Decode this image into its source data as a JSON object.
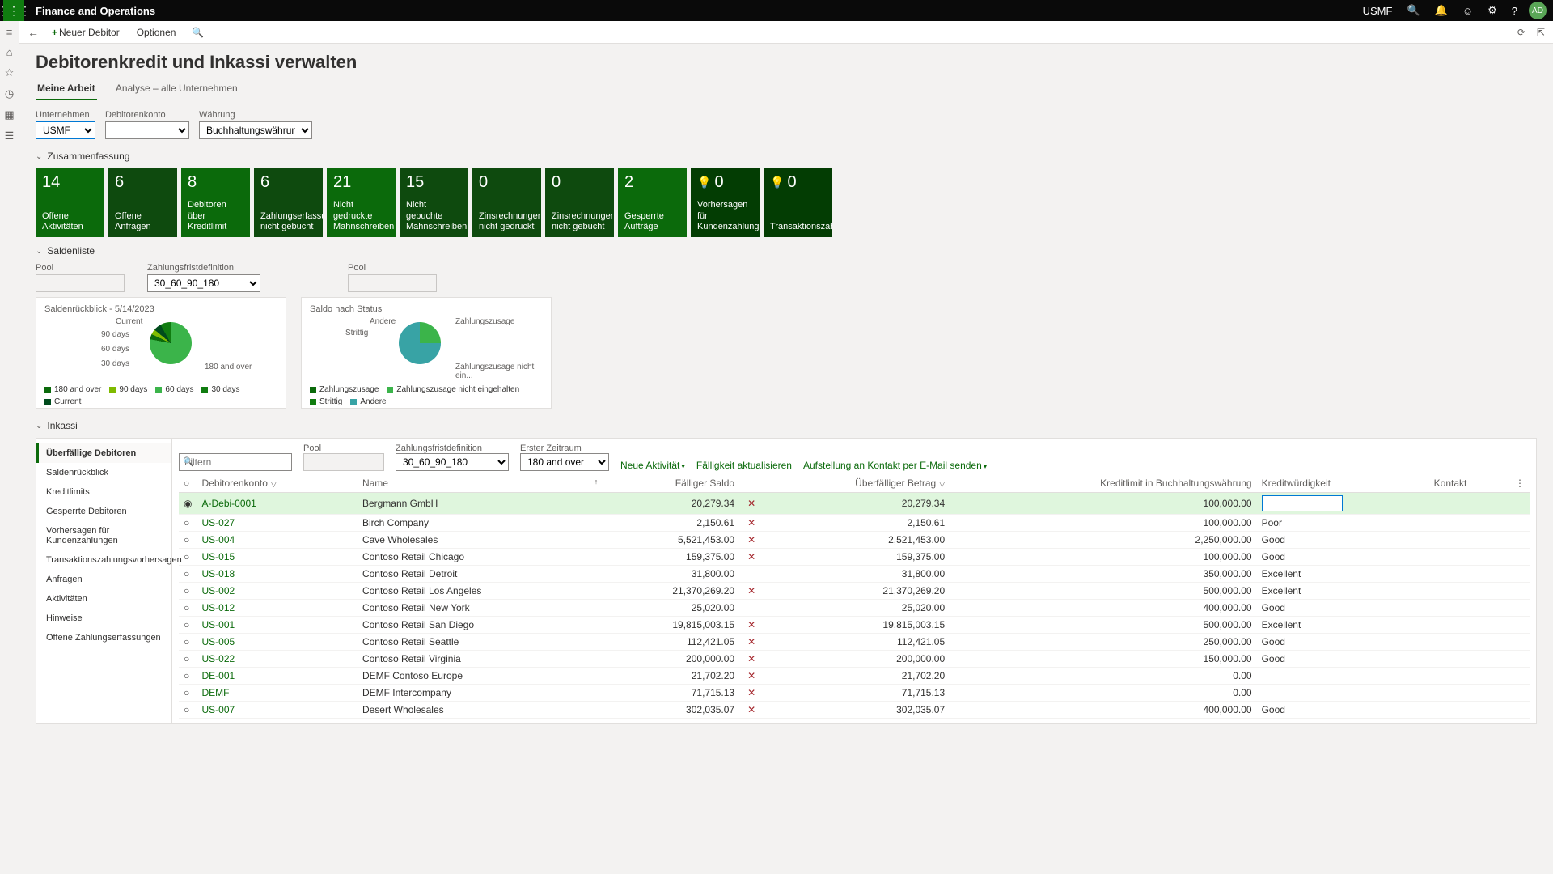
{
  "topbar": {
    "brand": "Finance and Operations",
    "company": "USMF",
    "avatar": "AD"
  },
  "actionbar": {
    "new": "Neuer Debitor",
    "options": "Optionen"
  },
  "page": {
    "title": "Debitorenkredit und Inkassi verwalten",
    "tab1": "Meine Arbeit",
    "tab2": "Analyse – alle Unternehmen"
  },
  "filters": {
    "company_lbl": "Unternehmen",
    "company_val": "USMF",
    "account_lbl": "Debitorenkonto",
    "currency_lbl": "Währung",
    "currency_val": "Buchhaltungswährung"
  },
  "summary": {
    "title": "Zusammenfassung",
    "tiles": [
      {
        "n": "14",
        "c": "Offene Aktivitäten"
      },
      {
        "n": "6",
        "c": "Offene Anfragen"
      },
      {
        "n": "8",
        "c": "Debitoren über Kreditlimit"
      },
      {
        "n": "6",
        "c": "Zahlungserfassung nicht gebucht"
      },
      {
        "n": "21",
        "c": "Nicht gedruckte Mahnschreiben"
      },
      {
        "n": "15",
        "c": "Nicht gebuchte Mahnschreiben"
      },
      {
        "n": "0",
        "c": "Zinsrechnungen nicht gedruckt"
      },
      {
        "n": "0",
        "c": "Zinsrechnungen nicht gebucht"
      },
      {
        "n": "2",
        "c": "Gesperrte Aufträge"
      },
      {
        "n": "0",
        "c": "Vorhersagen für Kundenzahlungen",
        "icon": true
      },
      {
        "n": "0",
        "c": "Transaktionszahlungsvorhersagen",
        "icon": true
      }
    ]
  },
  "balances": {
    "title": "Saldenliste",
    "pool_lbl": "Pool",
    "aging_lbl": "Zahlungsfristdefinition",
    "aging_val": "30_60_90_180",
    "pool2_lbl": "Pool",
    "chart1_title": "Saldenrückblick - 5/14/2023",
    "chart2_title": "Saldo nach Status",
    "legend1": [
      "180 and over",
      "90 days",
      "60 days",
      "30 days",
      "Current"
    ],
    "legend2": [
      "Zahlungszusage",
      "Zahlungszusage nicht eingehalten",
      "Strittig",
      "Andere"
    ],
    "pie1_labels": {
      "current": "Current",
      "d90": "90 days",
      "d60": "60 days",
      "d30": "30 days",
      "d180": "180 and over"
    },
    "pie2_labels": {
      "andere": "Andere",
      "strittig": "Strittig",
      "zz": "Zahlungszusage",
      "zzne": "Zahlungszusage nicht ein..."
    }
  },
  "chart_data": [
    {
      "type": "pie",
      "title": "Saldenrückblick - 5/14/2023",
      "categories": [
        "Current",
        "30 days",
        "60 days",
        "90 days",
        "180 and over"
      ],
      "values": [
        78,
        4,
        4,
        6,
        8
      ]
    },
    {
      "type": "pie",
      "title": "Saldo nach Status",
      "categories": [
        "Zahlungszusage",
        "Zahlungszusage nicht eingehalten",
        "Strittig",
        "Andere"
      ],
      "values": [
        15,
        5,
        5,
        75
      ]
    }
  ],
  "inkasso": {
    "title": "Inkassi",
    "side": [
      "Überfällige Debitoren",
      "Saldenrückblick",
      "Kreditlimits",
      "Gesperrte Debitoren",
      "Vorhersagen für Kundenzahlungen",
      "Transaktionszahlungsvorhersagen",
      "Anfragen",
      "Aktivitäten",
      "Hinweise",
      "Offene Zahlungserfassungen"
    ],
    "filter_placeholder": "Filtern",
    "pool_lbl": "Pool",
    "aging_lbl": "Zahlungsfristdefinition",
    "aging_val": "30_60_90_180",
    "period_lbl": "Erster Zeitraum",
    "period_val": "180 and over",
    "act_new": "Neue Aktivität",
    "act_update": "Fälligkeit aktualisieren",
    "act_send": "Aufstellung an Kontakt per E-Mail senden",
    "cols": {
      "acct": "Debitorenkonto",
      "name": "Name",
      "due": "Fälliger Saldo",
      "overdue": "Überfälliger Betrag",
      "limit": "Kreditlimit in Buchhaltungswährung",
      "cred": "Kreditwürdigkeit",
      "contact": "Kontakt"
    },
    "rows": [
      {
        "acct": "A-Debi-0001",
        "name": "Bergmann GmbH",
        "due": "20,279.34",
        "x": true,
        "over": "20,279.34",
        "lim": "100,000.00",
        "cred": "",
        "sel": true
      },
      {
        "acct": "US-027",
        "name": "Birch Company",
        "due": "2,150.61",
        "x": true,
        "over": "2,150.61",
        "lim": "100,000.00",
        "cred": "Poor"
      },
      {
        "acct": "US-004",
        "name": "Cave Wholesales",
        "due": "5,521,453.00",
        "x": true,
        "over": "2,521,453.00",
        "lim": "2,250,000.00",
        "cred": "Good"
      },
      {
        "acct": "US-015",
        "name": "Contoso Retail Chicago",
        "due": "159,375.00",
        "x": true,
        "over": "159,375.00",
        "lim": "100,000.00",
        "cred": "Good"
      },
      {
        "acct": "US-018",
        "name": "Contoso Retail Detroit",
        "due": "31,800.00",
        "x": false,
        "over": "31,800.00",
        "lim": "350,000.00",
        "cred": "Excellent"
      },
      {
        "acct": "US-002",
        "name": "Contoso Retail Los Angeles",
        "due": "21,370,269.20",
        "x": true,
        "over": "21,370,269.20",
        "lim": "500,000.00",
        "cred": "Excellent"
      },
      {
        "acct": "US-012",
        "name": "Contoso Retail New York",
        "due": "25,020.00",
        "x": false,
        "over": "25,020.00",
        "lim": "400,000.00",
        "cred": "Good"
      },
      {
        "acct": "US-001",
        "name": "Contoso Retail San Diego",
        "due": "19,815,003.15",
        "x": true,
        "over": "19,815,003.15",
        "lim": "500,000.00",
        "cred": "Excellent"
      },
      {
        "acct": "US-005",
        "name": "Contoso Retail Seattle",
        "due": "112,421.05",
        "x": true,
        "over": "112,421.05",
        "lim": "250,000.00",
        "cred": "Good"
      },
      {
        "acct": "US-022",
        "name": "Contoso Retail Virginia",
        "due": "200,000.00",
        "x": true,
        "over": "200,000.00",
        "lim": "150,000.00",
        "cred": "Good"
      },
      {
        "acct": "DE-001",
        "name": "DEMF Contoso Europe",
        "due": "21,702.20",
        "x": true,
        "over": "21,702.20",
        "lim": "0.00",
        "cred": ""
      },
      {
        "acct": "DEMF",
        "name": "DEMF Intercompany",
        "due": "71,715.13",
        "x": true,
        "over": "71,715.13",
        "lim": "0.00",
        "cred": ""
      },
      {
        "acct": "US-007",
        "name": "Desert Wholesales",
        "due": "302,035.07",
        "x": true,
        "over": "302,035.07",
        "lim": "400,000.00",
        "cred": "Good"
      }
    ]
  }
}
